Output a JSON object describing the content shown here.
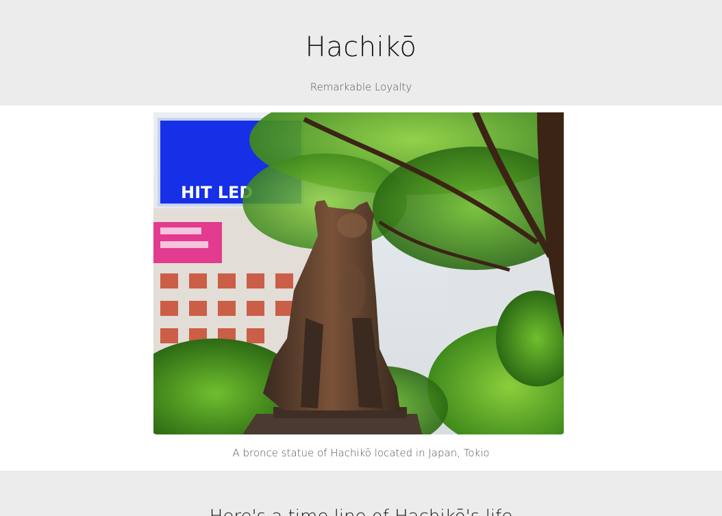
{
  "header": {
    "title": "Hachikō",
    "subtitle": "Remarkable Loyalty"
  },
  "figure": {
    "image_alt": "A bronce statue of Hachikō located in Japan, Tokio",
    "billboard_text": "HIT LED",
    "caption": "A bronce statue of Hachikō located in Japan, Tokio"
  },
  "timeline": {
    "heading": "Here's a time line of Hachikō's life"
  },
  "colors": {
    "header_bg": "#ececec",
    "page_bg": "#ffffff",
    "text_dark": "#111111",
    "text_muted": "#555555"
  }
}
